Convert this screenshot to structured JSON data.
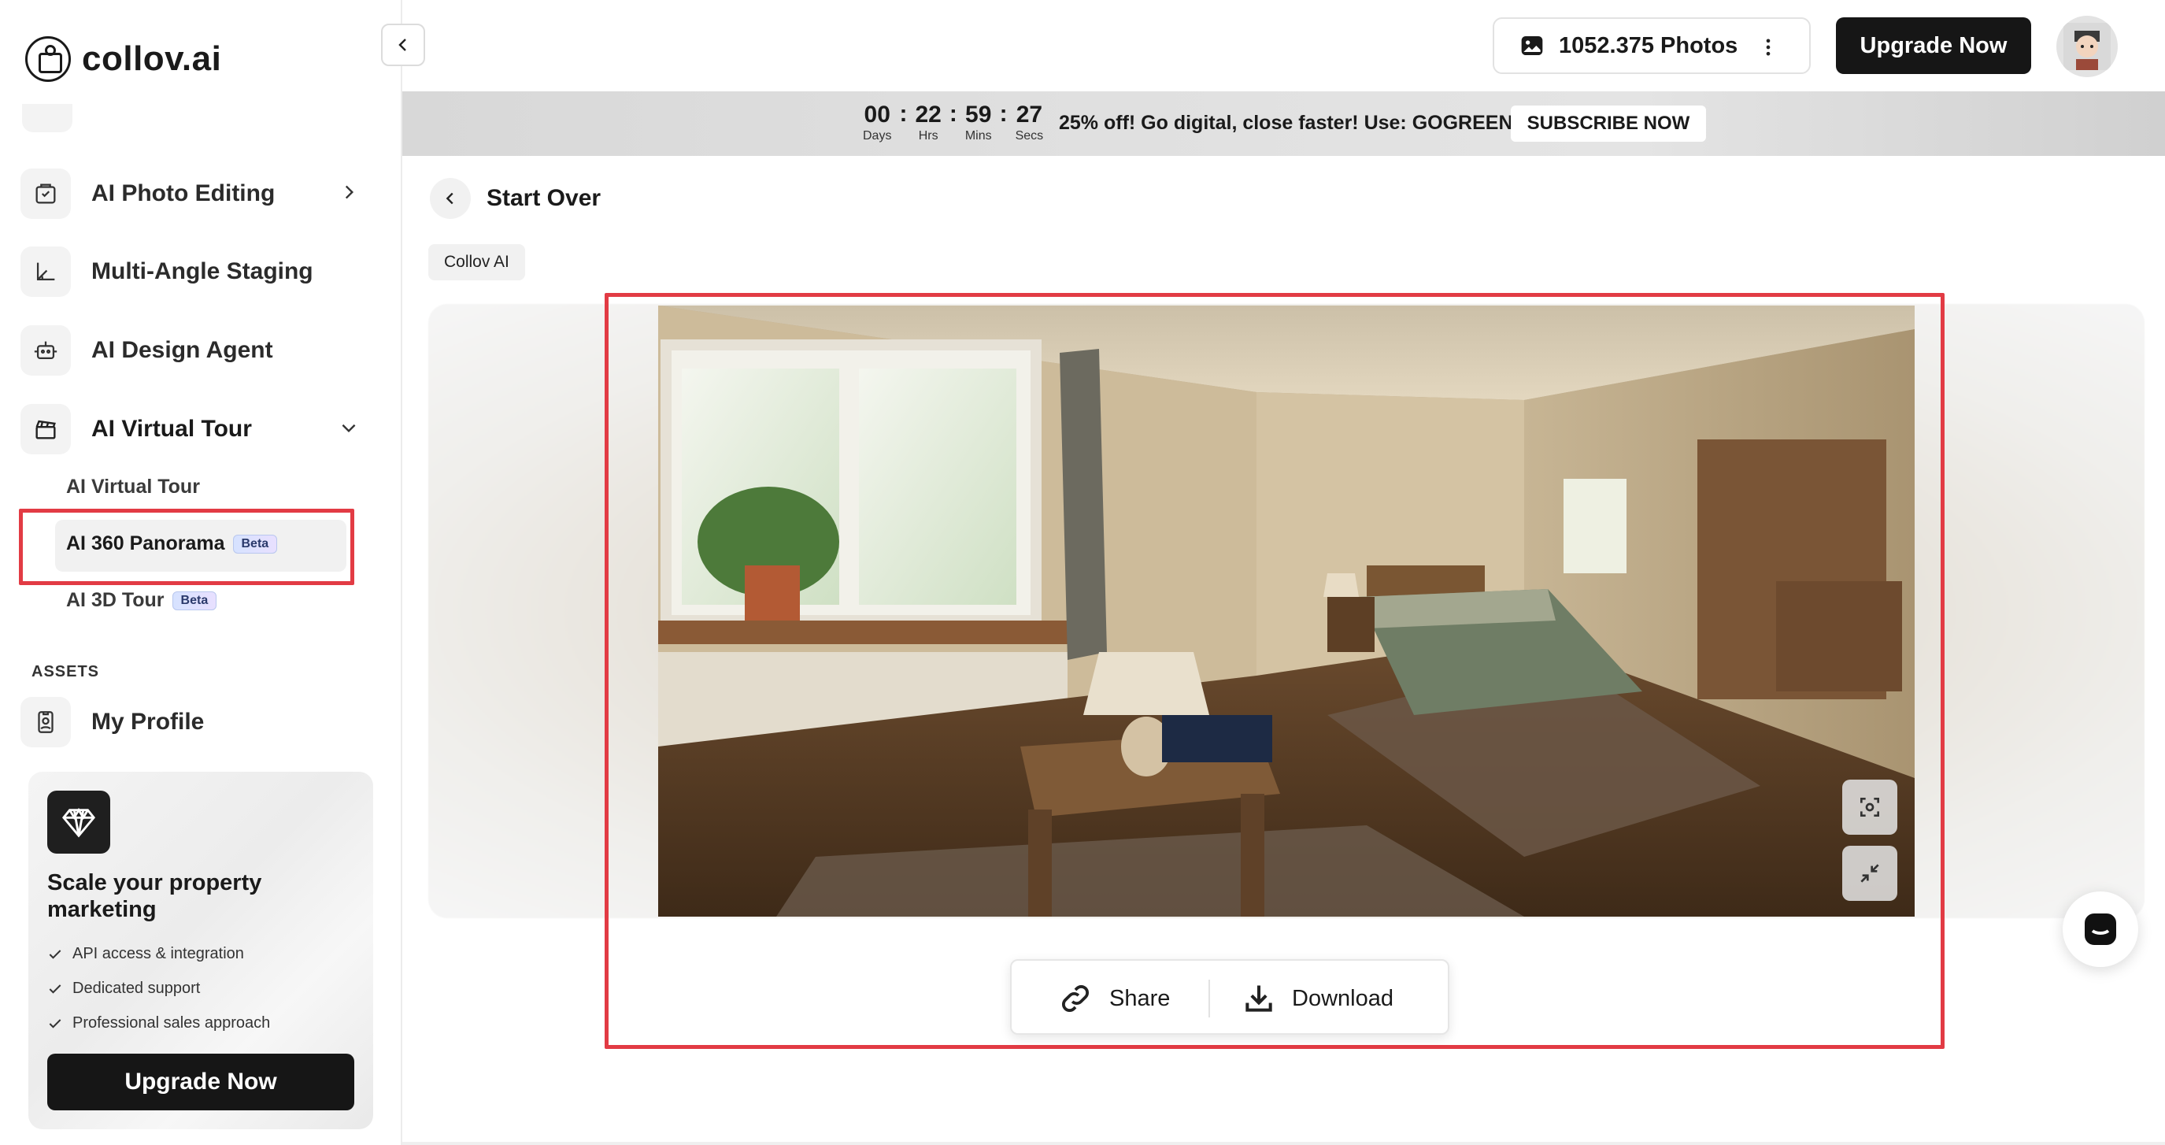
{
  "app": {
    "logo_text": "collov.ai"
  },
  "header": {
    "photos_label": "1052.375 Photos",
    "upgrade_label": "Upgrade Now"
  },
  "sidebar": {
    "items": [
      {
        "label": "AI Photo Editing",
        "icon": "photo-edit-icon"
      },
      {
        "label": "Multi-Angle Staging",
        "icon": "multi-angle-icon"
      },
      {
        "label": "AI Design Agent",
        "icon": "robot-icon"
      },
      {
        "label": "AI Virtual Tour",
        "icon": "clapper-icon"
      }
    ],
    "subitems": [
      {
        "label": "AI Virtual Tour"
      },
      {
        "label": "AI 360 Panorama",
        "badge": "Beta"
      },
      {
        "label": "AI 3D Tour",
        "badge": "Beta"
      }
    ],
    "section_assets": "ASSETS",
    "profile_label": "My Profile",
    "promo": {
      "title": "Scale your property marketing",
      "features": [
        "API access & integration",
        "Dedicated support",
        "Professional sales approach"
      ],
      "button": "Upgrade Now"
    }
  },
  "banner": {
    "countdown": [
      {
        "value": "00",
        "unit": "Days"
      },
      {
        "value": "22",
        "unit": "Hrs"
      },
      {
        "value": "59",
        "unit": "Mins"
      },
      {
        "value": "27",
        "unit": "Secs"
      }
    ],
    "promo_text": "25% off! Go digital, close faster! Use: GOGREEN",
    "subscribe_label": "SUBSCRIBE NOW"
  },
  "main": {
    "start_over_label": "Start Over",
    "tag_label": "Collov AI",
    "share_label": "Share",
    "download_label": "Download"
  },
  "colors": {
    "accent_red": "#e23b44",
    "dark_button": "#161616"
  }
}
